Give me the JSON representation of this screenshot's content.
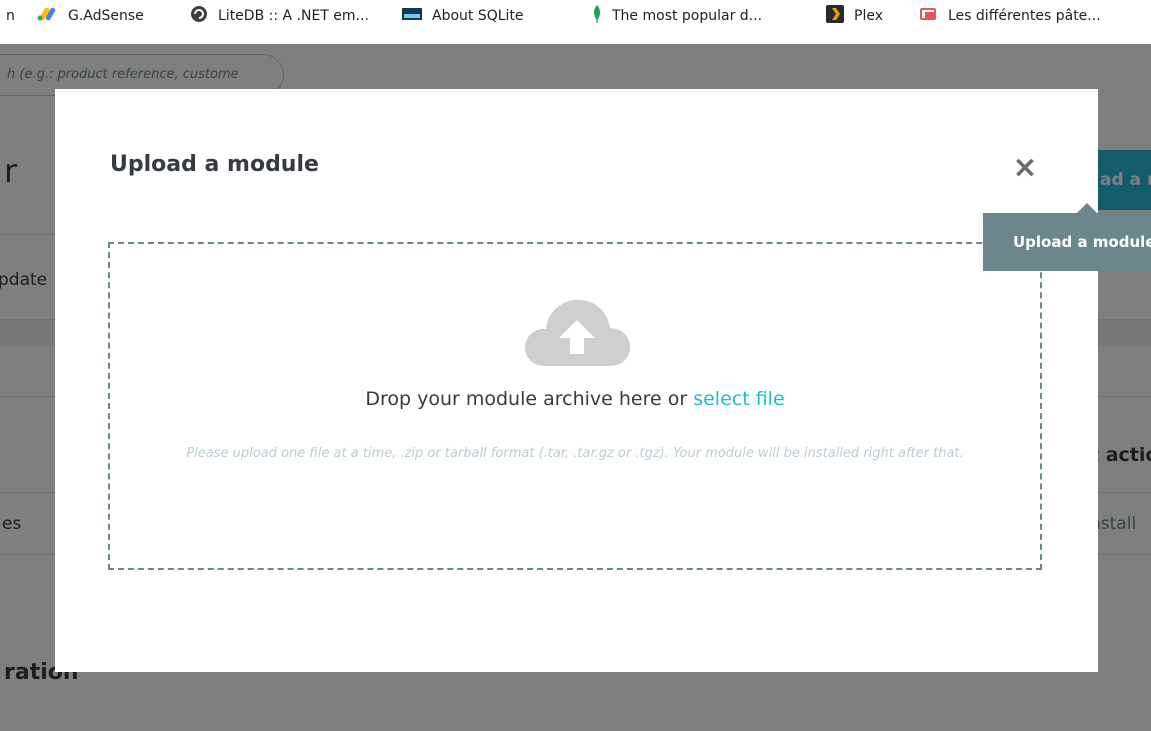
{
  "bookmarks": [
    {
      "label": "n",
      "icon": "bookmark-icon"
    },
    {
      "label": "G.AdSense",
      "icon": "google-ads-icon"
    },
    {
      "label": "LiteDB :: A .NET em...",
      "icon": "litedb-icon"
    },
    {
      "label": "About SQLite",
      "icon": "sqlite-icon"
    },
    {
      "label": "The most popular d...",
      "icon": "mongodb-leaf-icon"
    },
    {
      "label": "Plex",
      "icon": "plex-icon"
    },
    {
      "label": "Les différentes pâte...",
      "icon": "bookmark-icon"
    }
  ],
  "background": {
    "search_placeholder": "h (e.g.: product reference, custome",
    "title_fragment": "r",
    "tab_fragment": "pdate",
    "row_fragment": "es",
    "section_fragment": "ration",
    "upload_button_fragment": "ad a m",
    "action_fragment": "t actio",
    "install_fragment": "nstall"
  },
  "modal": {
    "title": "Upload a module",
    "close_symbol": "×",
    "drop_text": "Drop your module archive here or",
    "select_file_link": "select file",
    "hint": "Please upload one file at a time, .zip or tarball format (.tar, .tar.gz or .tgz). Your module will be installed right after that."
  },
  "tooltip": {
    "text": "Upload a module"
  },
  "colors": {
    "accent": "#25b9d7",
    "tooltip_bg": "#6c868e",
    "overlay": "rgba(0,0,0,0.5)"
  }
}
